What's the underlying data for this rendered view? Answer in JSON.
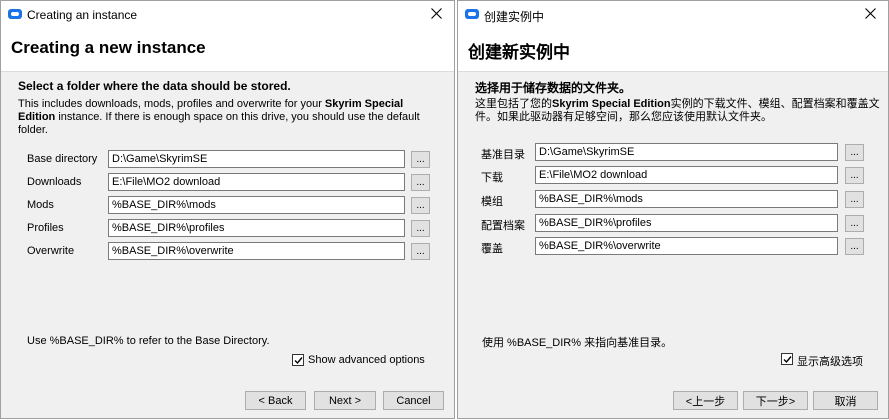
{
  "left": {
    "window_title": "Creating an instance",
    "heading": "Creating a new instance",
    "subheading": "Select a folder where the data should be stored.",
    "desc_prefix": "This includes downloads, mods, profiles and overwrite for your ",
    "desc_game": "Skyrim Special Edition",
    "desc_suffix": " instance. If there is enough space on this drive, you should use the default folder.",
    "fields": [
      {
        "label": "Base directory",
        "value": "D:\\Game\\SkyrimSE"
      },
      {
        "label": "Downloads",
        "value": "E:\\File\\MO2 download"
      },
      {
        "label": "Mods",
        "value": "%BASE_DIR%\\mods"
      },
      {
        "label": "Profiles",
        "value": "%BASE_DIR%\\profiles"
      },
      {
        "label": "Overwrite",
        "value": "%BASE_DIR%\\overwrite"
      }
    ],
    "browse_label": "...",
    "footnote": "Use %BASE_DIR% to refer to the Base Directory.",
    "advanced_label": "Show advanced options",
    "back_label": "< Back",
    "next_label": "Next >",
    "cancel_label": "Cancel"
  },
  "right": {
    "window_title": "创建实例中",
    "heading": "创建新实例中",
    "subheading": "选择用于储存数据的文件夹。",
    "desc_prefix": "这里包括了您的",
    "desc_game": "Skyrim Special Edition",
    "desc_suffix": "实例的下载文件、模组、配置档案和覆盖文件。如果此驱动器有足够空间，那么您应该使用默认文件夹。",
    "fields": [
      {
        "label": "基准目录",
        "value": "D:\\Game\\SkyrimSE"
      },
      {
        "label": "下载",
        "value": "E:\\File\\MO2 download"
      },
      {
        "label": "模组",
        "value": "%BASE_DIR%\\mods"
      },
      {
        "label": "配置档案",
        "value": "%BASE_DIR%\\profiles"
      },
      {
        "label": "覆盖",
        "value": "%BASE_DIR%\\overwrite"
      }
    ],
    "browse_label": "...",
    "footnote": "使用 %BASE_DIR% 来指向基准目录。",
    "advanced_label": "显示高级选项",
    "back_label": "<上一步",
    "next_label": "下一步>",
    "cancel_label": "取消"
  },
  "colors": {
    "accent": "#1a73e8",
    "dialog_bg": "#f0f0f0",
    "button_bg": "#e1e1e1"
  }
}
